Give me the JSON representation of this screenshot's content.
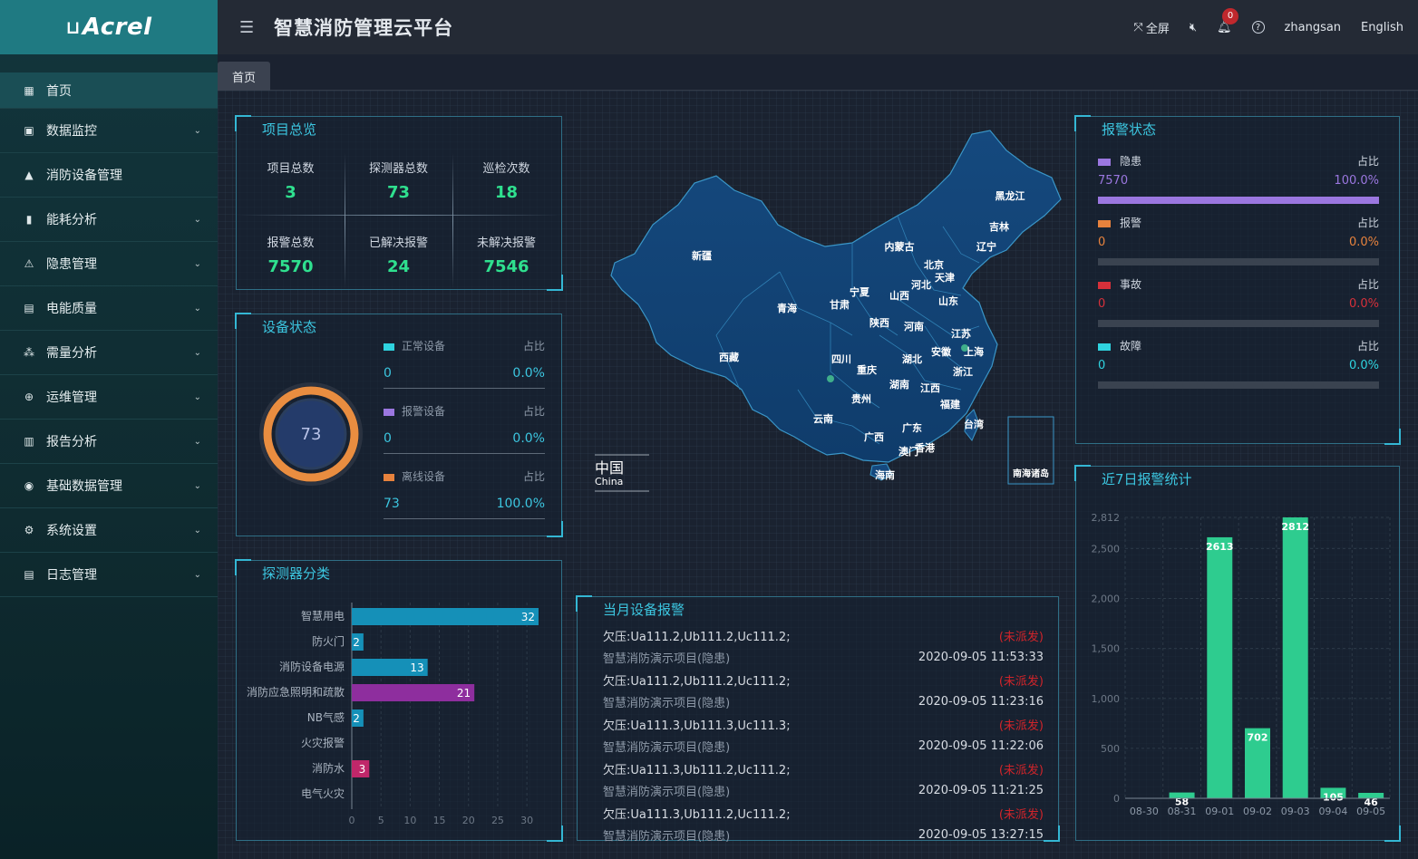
{
  "logo": {
    "text": "Acrel",
    "mark": "⊔"
  },
  "sidebar": {
    "items": [
      {
        "label": "首页",
        "icon": "dashboard-icon",
        "glyph": "▦",
        "active": true,
        "has_children": false
      },
      {
        "label": "数据监控",
        "icon": "monitor-icon",
        "glyph": "▣",
        "has_children": true
      },
      {
        "label": "消防设备管理",
        "icon": "extinguisher-icon",
        "glyph": "▲",
        "has_children": false
      },
      {
        "label": "能耗分析",
        "icon": "bar-chart-icon",
        "glyph": "▮",
        "has_children": true
      },
      {
        "label": "隐患管理",
        "icon": "warning-icon",
        "glyph": "⚠",
        "has_children": true
      },
      {
        "label": "电能质量",
        "icon": "calendar-icon",
        "glyph": "▤",
        "has_children": true
      },
      {
        "label": "需量分析",
        "icon": "cluster-icon",
        "glyph": "⁂",
        "has_children": true
      },
      {
        "label": "运维管理",
        "icon": "globe-icon",
        "glyph": "⊕",
        "has_children": true
      },
      {
        "label": "报告分析",
        "icon": "report-icon",
        "glyph": "▥",
        "has_children": true
      },
      {
        "label": "基础数据管理",
        "icon": "database-icon",
        "glyph": "◉",
        "has_children": true
      },
      {
        "label": "系统设置",
        "icon": "settings-icon",
        "glyph": "⚙",
        "has_children": true
      },
      {
        "label": "日志管理",
        "icon": "log-icon",
        "glyph": "▤",
        "has_children": true
      }
    ]
  },
  "header": {
    "title": "智慧消防管理云平台",
    "fullscreen": "全屏",
    "notification_count": "0",
    "username": "zhangsan",
    "language": "English"
  },
  "tabs": [
    {
      "label": "首页"
    }
  ],
  "overview": {
    "title": "项目总览",
    "cells": [
      {
        "label": "项目总数",
        "value": "3"
      },
      {
        "label": "探测器总数",
        "value": "73"
      },
      {
        "label": "巡检次数",
        "value": "18"
      },
      {
        "label": "报警总数",
        "value": "7570"
      },
      {
        "label": "已解决报警",
        "value": "24"
      },
      {
        "label": "未解决报警",
        "value": "7546"
      }
    ]
  },
  "device_status": {
    "title": "设备状态",
    "total": "73",
    "ratio_label": "占比",
    "items": [
      {
        "label": "正常设备",
        "value": "0",
        "ratio": "0.0%",
        "color": "#2fd3df"
      },
      {
        "label": "报警设备",
        "value": "0",
        "ratio": "0.0%",
        "color": "#9b77e0"
      },
      {
        "label": "离线设备",
        "value": "73",
        "ratio": "100.0%",
        "color": "#e7823d"
      }
    ]
  },
  "detector_category": {
    "title": "探测器分类"
  },
  "map": {
    "china_zh": "中国",
    "china_en": "China",
    "south_islands": "南海诸岛",
    "provinces": [
      "黑龙江",
      "吉林",
      "辽宁",
      "内蒙古",
      "北京",
      "天津",
      "河北",
      "宁夏",
      "山西",
      "山东",
      "新疆",
      "青海",
      "甘肃",
      "陕西",
      "河南",
      "江苏",
      "安徽",
      "上海",
      "西藏",
      "四川",
      "湖北",
      "重庆",
      "浙江",
      "湖南",
      "江西",
      "贵州",
      "福建",
      "云南",
      "广东",
      "台湾",
      "广西",
      "澳门",
      "香港",
      "海南"
    ]
  },
  "monthly_alarms": {
    "title": "当月设备报警",
    "rows": [
      {
        "text": "欠压:Ua111.2,Ub111.2,Uc111.2;",
        "right": "(未派发)",
        "kind": "detail"
      },
      {
        "text": "智慧消防演示项目(隐患)",
        "right": "2020-09-05 11:53:33",
        "kind": "head"
      },
      {
        "text": "欠压:Ua111.2,Ub111.2,Uc111.2;",
        "right": "(未派发)",
        "kind": "detail"
      },
      {
        "text": "智慧消防演示项目(隐患)",
        "right": "2020-09-05 11:23:16",
        "kind": "head"
      },
      {
        "text": "欠压:Ua111.3,Ub111.3,Uc111.3;",
        "right": "(未派发)",
        "kind": "detail"
      },
      {
        "text": "智慧消防演示项目(隐患)",
        "right": "2020-09-05 11:22:06",
        "kind": "head"
      },
      {
        "text": "欠压:Ua111.3,Ub111.2,Uc111.2;",
        "right": "(未派发)",
        "kind": "detail"
      },
      {
        "text": "智慧消防演示项目(隐患)",
        "right": "2020-09-05 11:21:25",
        "kind": "head"
      },
      {
        "text": "欠压:Ua111.3,Ub111.2,Uc111.2;",
        "right": "(未派发)",
        "kind": "detail"
      },
      {
        "text": "智慧消防演示项目(隐患)",
        "right": "2020-09-05 13:27:15",
        "kind": "head"
      }
    ]
  },
  "alarm_status": {
    "title": "报警状态",
    "ratio_label": "占比",
    "items": [
      {
        "label": "隐患",
        "value": "7570",
        "ratio": "100.0%",
        "fraction": 1.0,
        "color": "#9b77e0"
      },
      {
        "label": "报警",
        "value": "0",
        "ratio": "0.0%",
        "fraction": 0.0,
        "color": "#e7823d"
      },
      {
        "label": "事故",
        "value": "0",
        "ratio": "0.0%",
        "fraction": 0.0,
        "color": "#d6303a"
      },
      {
        "label": "故障",
        "value": "0",
        "ratio": "0.0%",
        "fraction": 0.0,
        "color": "#2fd3df"
      }
    ]
  },
  "weekly_alarms": {
    "title": "近7日报警统计"
  },
  "chart_data": [
    {
      "type": "bar",
      "orientation": "horizontal",
      "categories": [
        "智慧用电",
        "防火门",
        "消防设备电源",
        "消防应急照明和疏散",
        "NB气感",
        "火灾报警",
        "消防水",
        "电气火灾"
      ],
      "values": [
        32,
        2,
        13,
        21,
        2,
        0,
        3,
        0
      ],
      "colors": [
        "#1590b8",
        "#1590b8",
        "#1590b8",
        "#8e2e9e",
        "#1590b8",
        "#1590b8",
        "#c0276a",
        "#1590b8"
      ],
      "xticks": [
        "0",
        "5",
        "10",
        "15",
        "20",
        "25",
        "30"
      ],
      "xlim": [
        0,
        32
      ]
    },
    {
      "type": "bar",
      "categories": [
        "08-30",
        "08-31",
        "09-01",
        "09-02",
        "09-03",
        "09-04",
        "09-05"
      ],
      "values": [
        0,
        58,
        2613,
        702,
        2812,
        105,
        46
      ],
      "yticks": [
        "0",
        "500",
        "1,000",
        "1,500",
        "2,000",
        "2,500",
        "2,812"
      ],
      "ylim": [
        0,
        2812
      ],
      "color": "#2ecc8f"
    }
  ]
}
